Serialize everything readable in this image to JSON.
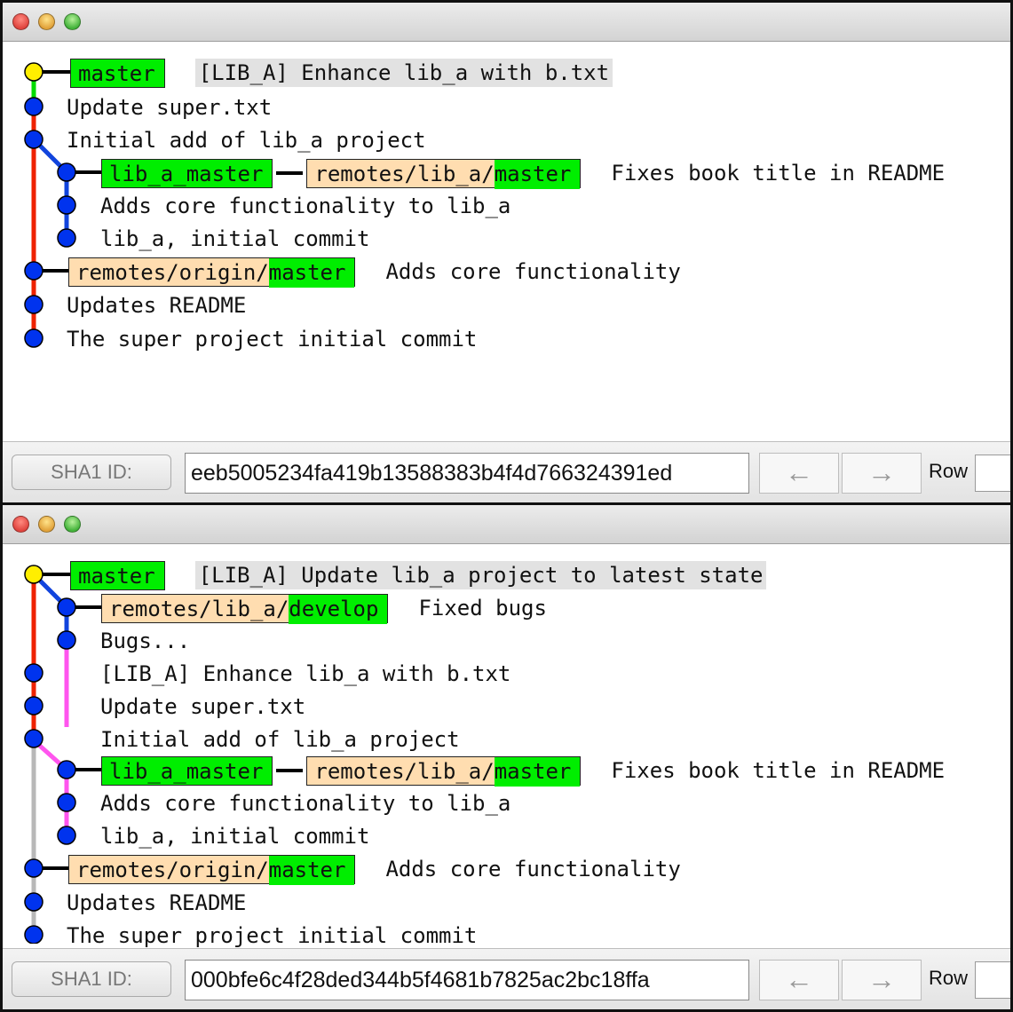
{
  "windows": [
    {
      "commits": [
        {
          "subject": "[LIB_A] Enhance lib_a with b.txt",
          "head": true,
          "refs": [
            {
              "kind": "local",
              "name": "master"
            }
          ]
        },
        {
          "subject": "Update super.txt",
          "refs": []
        },
        {
          "subject": "Initial add of lib_a project",
          "refs": []
        },
        {
          "subject": "Fixes book title in README",
          "refs": [
            {
              "kind": "local",
              "name": "lib_a_master"
            },
            {
              "kind": "remote",
              "prefix": "remotes/lib_a/",
              "name": "master"
            }
          ]
        },
        {
          "subject": "Adds core functionality to lib_a",
          "refs": []
        },
        {
          "subject": "lib_a, initial commit",
          "refs": []
        },
        {
          "subject": "Adds core functionality",
          "refs": [
            {
              "kind": "remote",
              "prefix": "remotes/origin/",
              "name": "master"
            }
          ]
        },
        {
          "subject": "Updates README",
          "refs": []
        },
        {
          "subject": "The super project initial commit",
          "refs": []
        }
      ],
      "statusbar": {
        "sha_label": "SHA1 ID:",
        "sha_value": "eeb5005234fa419b13588383b4f4d766324391ed",
        "back_icon": "←",
        "forward_icon": "→",
        "row_label": "Row"
      }
    },
    {
      "commits": [
        {
          "subject": "[LIB_A] Update lib_a project to latest state",
          "head": true,
          "refs": [
            {
              "kind": "local",
              "name": "master"
            }
          ]
        },
        {
          "subject": "Fixed bugs",
          "refs": [
            {
              "kind": "remote",
              "prefix": "remotes/lib_a/",
              "name": "develop"
            }
          ]
        },
        {
          "subject": "Bugs...",
          "refs": []
        },
        {
          "subject": "[LIB_A] Enhance lib_a with b.txt",
          "refs": []
        },
        {
          "subject": "Update super.txt",
          "refs": []
        },
        {
          "subject": "Initial add of lib_a project",
          "refs": []
        },
        {
          "subject": "Fixes book title in README",
          "refs": [
            {
              "kind": "local",
              "name": "lib_a_master"
            },
            {
              "kind": "remote",
              "prefix": "remotes/lib_a/",
              "name": "master"
            }
          ]
        },
        {
          "subject": "Adds core functionality to lib_a",
          "refs": []
        },
        {
          "subject": "lib_a, initial commit",
          "refs": []
        },
        {
          "subject": "Adds core functionality",
          "refs": [
            {
              "kind": "remote",
              "prefix": "remotes/origin/",
              "name": "master"
            }
          ]
        },
        {
          "subject": "Updates README",
          "refs": []
        },
        {
          "subject": "The super project initial commit",
          "refs": []
        }
      ],
      "statusbar": {
        "sha_label": "SHA1 ID:",
        "sha_value": "000bfe6c4f28ded344b5f4681b7825ac2bc18ffa",
        "back_icon": "←",
        "forward_icon": "→",
        "row_label": "Row"
      }
    }
  ],
  "colors": {
    "head_node": "#ffee00",
    "node": "#0033ee",
    "line_red": "#ee2200",
    "line_green": "#00dd00",
    "line_blue": "#1144dd",
    "line_pink": "#ff55ee",
    "line_gray": "#b8b8b8",
    "local_ref_bg": "#00ee00",
    "remote_ref_bg": "#ffddb0"
  }
}
